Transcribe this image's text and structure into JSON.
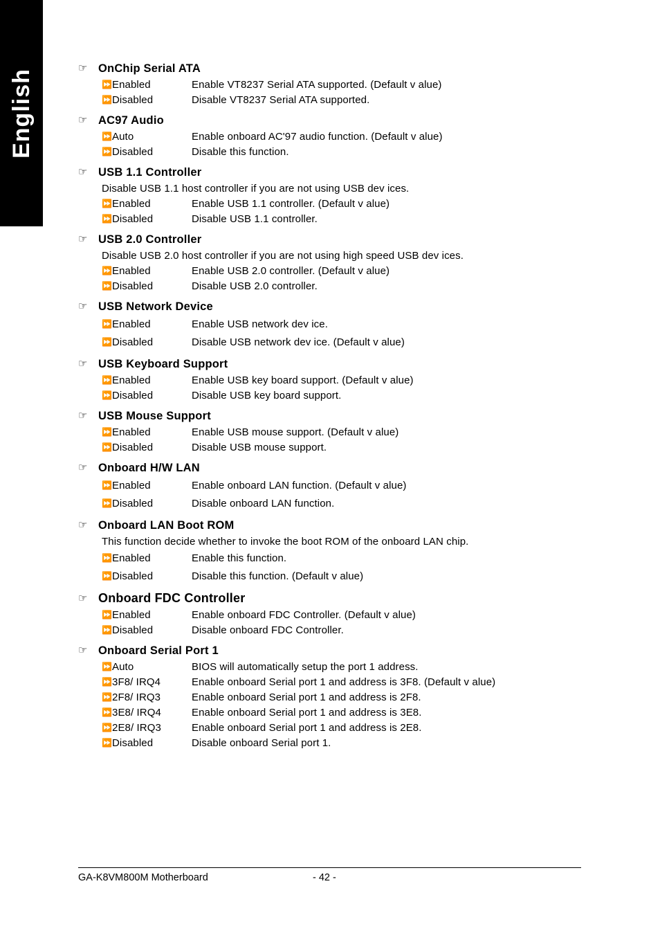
{
  "page": {
    "language_tab": "English",
    "section_bullet_icon": "pointing-hand-icon",
    "option_marker_icon": "double-right-arrow-icon"
  },
  "sections": [
    {
      "title": "OnChip Serial ATA",
      "note": null,
      "options": [
        {
          "label": "Enabled",
          "desc": "Enable VT8237 Serial ATA supported. (Default v alue)"
        },
        {
          "label": "Disabled",
          "desc": "Disable VT8237 Serial ATA supported."
        }
      ]
    },
    {
      "title": "AC97 Audio",
      "note": null,
      "options": [
        {
          "label": "Auto",
          "desc": "Enable onboard AC'97 audio function. (Default v alue)"
        },
        {
          "label": "Disabled",
          "desc": "Disable this function."
        }
      ]
    },
    {
      "title": "USB 1.1 Controller",
      "note": "Disable USB 1.1 host controller if you are not using USB dev ices.",
      "options": [
        {
          "label": "Enabled",
          "desc": "Enable USB 1.1 controller. (Default v alue)"
        },
        {
          "label": "Disabled",
          "desc": "Disable USB 1.1 controller."
        }
      ]
    },
    {
      "title": "USB 2.0 Controller",
      "note": "Disable USB 2.0 host controller if you are not using high speed USB dev ices.",
      "options": [
        {
          "label": "Enabled",
          "desc": "Enable USB 2.0 controller. (Default v alue)"
        },
        {
          "label": "Disabled",
          "desc": "Disable USB 2.0 controller."
        }
      ]
    },
    {
      "title": "USB Network Device",
      "note": null,
      "options": [
        {
          "label": "Enabled",
          "desc": "Enable USB network dev ice."
        },
        {
          "label": "Disabled",
          "desc": "Disable USB network dev ice. (Default v alue)"
        }
      ]
    },
    {
      "title": "USB Keyboard Support",
      "note": null,
      "options": [
        {
          "label": "Enabled",
          "desc": "Enable USB key board support. (Default v alue)"
        },
        {
          "label": "Disabled",
          "desc": "Disable USB key board support."
        }
      ]
    },
    {
      "title": "USB Mouse Support",
      "note": null,
      "options": [
        {
          "label": "Enabled",
          "desc": "Enable USB mouse support. (Default v alue)"
        },
        {
          "label": "Disabled",
          "desc": "Disable USB mouse support."
        }
      ]
    },
    {
      "title": "Onboard H/W LAN",
      "note": null,
      "options": [
        {
          "label": "Enabled",
          "desc": "Enable onboard LAN function. (Default v alue)"
        },
        {
          "label": "Disabled",
          "desc": "Disable onboard LAN function."
        }
      ]
    },
    {
      "title": "Onboard LAN Boot ROM",
      "note": "This function decide whether to invoke the boot ROM of the onboard LAN chip.",
      "options": [
        {
          "label": "Enabled",
          "desc": "Enable this function."
        },
        {
          "label": "Disabled",
          "desc": "Disable this function. (Default v alue)"
        }
      ]
    },
    {
      "title": "Onboard FDC Controller",
      "note": null,
      "emphasis": true,
      "options": [
        {
          "label": "Enabled",
          "desc": "Enable onboard FDC Controller. (Default v alue)"
        },
        {
          "label": "Disabled",
          "desc": "Disable onboard FDC Controller."
        }
      ]
    },
    {
      "title": "Onboard Serial Port 1",
      "note": null,
      "options": [
        {
          "label": "Auto",
          "desc": "BIOS will automatically setup the port 1 address."
        },
        {
          "label": "3F8/ IRQ4",
          "desc": "Enable onboard Serial port 1 and address is 3F8. (Default v alue)"
        },
        {
          "label": "2F8/ IRQ3",
          "desc": "Enable onboard Serial port 1 and address is 2F8."
        },
        {
          "label": "3E8/ IRQ4",
          "desc": "Enable onboard Serial port 1 and address is 3E8."
        },
        {
          "label": "2E8/ IRQ3",
          "desc": "Enable onboard Serial port 1 and address is 2E8."
        },
        {
          "label": "Disabled",
          "desc": "Disable onboard Serial port 1."
        }
      ]
    }
  ],
  "footer": {
    "document": "GA-K8VM800M Motherboard",
    "page_number": "- 42 -"
  }
}
